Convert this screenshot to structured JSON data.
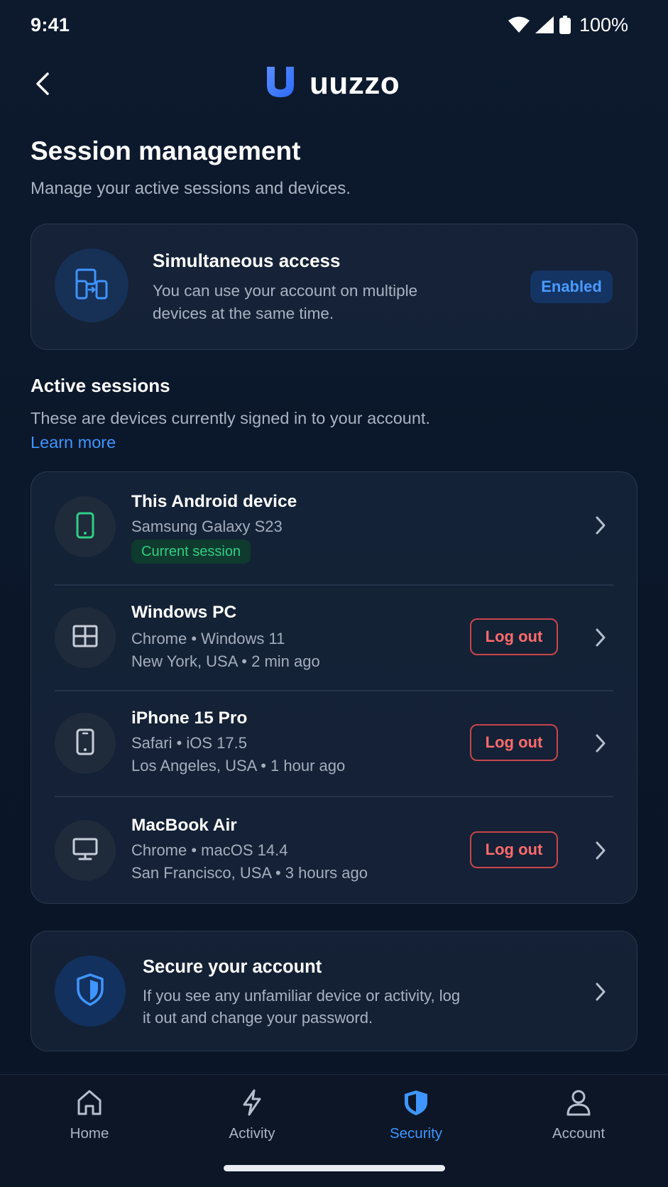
{
  "status_bar": {
    "time": "9:41",
    "battery": "100%"
  },
  "header": {
    "logo_text": "uuzzo"
  },
  "page": {
    "title": "Session management",
    "subtitle": "Manage your active sessions and devices."
  },
  "simultaneous_access": {
    "title": "Simultaneous access",
    "description": "You can use your account on multiple devices at the same time.",
    "badge": "Enabled"
  },
  "active_sessions": {
    "title": "Active sessions",
    "description": "These are devices currently signed in to your account.",
    "learn_more": "Learn more",
    "logout_label": "Log out",
    "items": [
      {
        "name": "This Android device",
        "line1": "Samsung Galaxy S23",
        "badge": "Current session",
        "icon": "smartphone-icon"
      },
      {
        "name": "Windows PC",
        "line1": "Chrome • Windows 11",
        "line2": "New York, USA • 2 min ago",
        "icon": "windows-icon"
      },
      {
        "name": "iPhone 15 Pro",
        "line1": "Safari • iOS 17.5",
        "line2": "Los Angeles, USA • 1 hour ago",
        "icon": "smartphone-icon"
      },
      {
        "name": "MacBook Air",
        "line1": "Chrome • macOS 14.4",
        "line2": "San Francisco, USA • 3 hours ago",
        "icon": "monitor-icon"
      }
    ]
  },
  "secure": {
    "title": "Secure your account",
    "description": "If you see any unfamiliar device or activity, log it out and change your password."
  },
  "nav": {
    "items": [
      {
        "label": "Home",
        "icon": "home-icon"
      },
      {
        "label": "Activity",
        "icon": "lightning-icon"
      },
      {
        "label": "Security",
        "icon": "shield-icon",
        "active": true
      },
      {
        "label": "Account",
        "icon": "user-icon"
      }
    ]
  },
  "colors": {
    "background": "#0b1628",
    "accent": "#3f95ff",
    "danger": "#ff6b6b",
    "success": "#2fcf84"
  }
}
